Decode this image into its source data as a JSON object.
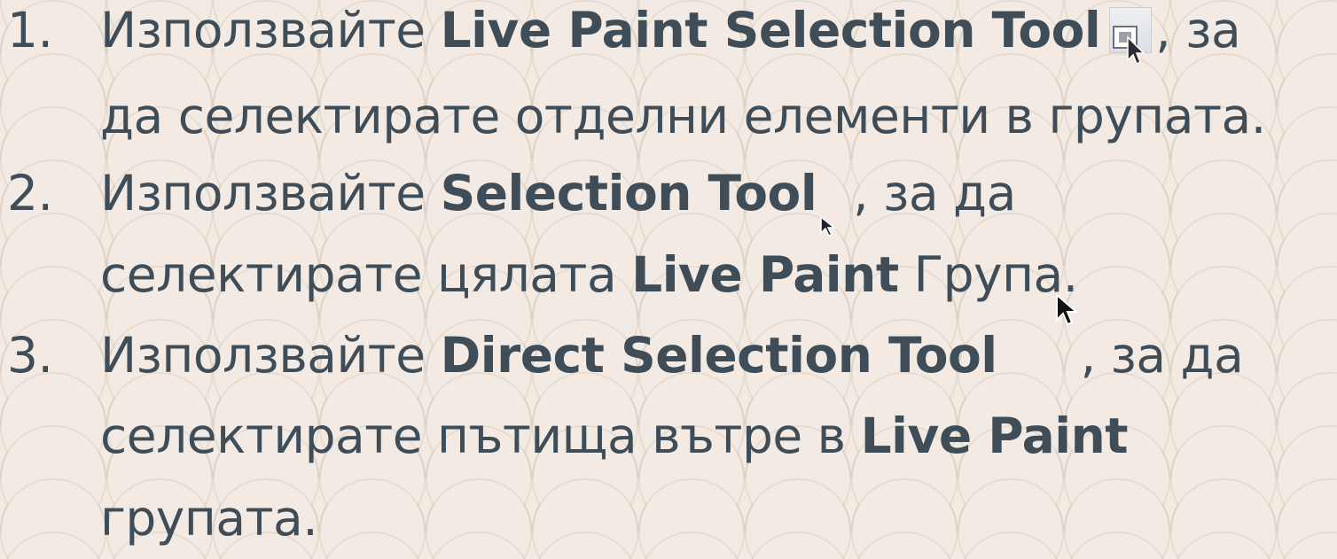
{
  "items": [
    {
      "number": "1.",
      "line1": {
        "pre": "Използвайте ",
        "bold": "Live Paint Selection Tool",
        "post": ", за"
      },
      "line2": {
        "text": "да селектирате отделни елементи в групата."
      }
    },
    {
      "number": "2.",
      "line1": {
        "pre": "Използвайте ",
        "bold": "Selection Tool",
        "post": " , за да"
      },
      "line2": {
        "pre": "селектирате цялата ",
        "bold": "Live Paint",
        "post": " Група."
      }
    },
    {
      "number": "3.",
      "line1": {
        "pre": "Използвайте ",
        "bold": "Direct Selection Tool",
        "post": ", за да"
      },
      "line2": {
        "pre": "селектирате пътища вътре в ",
        "bold": "Live Paint"
      },
      "line3": {
        "text": "групата."
      }
    }
  ],
  "icons": {
    "live_paint_selection": "live-paint-selection-tool-icon",
    "selection": "selection-tool-arrow-icon",
    "direct_selection": "direct-selection-tool-icon",
    "mouse_cursor": "mouse-cursor-icon"
  }
}
